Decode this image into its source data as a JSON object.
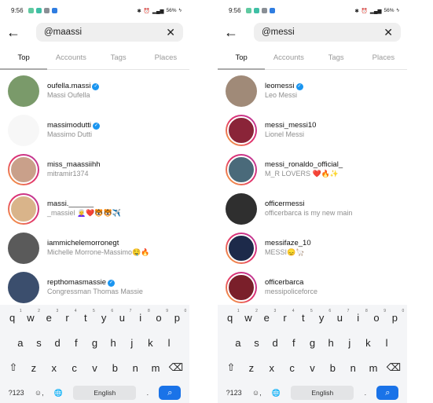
{
  "status_bar": {
    "time": "9:56",
    "battery": "56%",
    "app_colors": [
      "#5fc9a0",
      "#3fbfa5",
      "#8a8f95",
      "#2f7de1"
    ]
  },
  "tabs": [
    "Top",
    "Accounts",
    "Tags",
    "Places"
  ],
  "active_tab": "Top",
  "panels": [
    {
      "query": "@maassi",
      "results": [
        {
          "username": "oufella.massi",
          "subtitle": "Massi Oufella",
          "verified": true,
          "story_ring": false,
          "avatar_color": "#7a9a6a"
        },
        {
          "username": "massimodutti",
          "subtitle": "Massimo Dutti",
          "verified": true,
          "story_ring": false,
          "avatar_color": "#f7f7f7"
        },
        {
          "username": "miss_maassiihh",
          "subtitle": "mitramir1374",
          "verified": false,
          "story_ring": true,
          "avatar_color": "#c9a08a"
        },
        {
          "username": "massi.______",
          "subtitle": "_massiel 👩‍🦳❤️🐯🐯✈️",
          "verified": false,
          "story_ring": true,
          "avatar_color": "#d9b48a"
        },
        {
          "username": "iammichelemorronegt",
          "subtitle": "Michelle Morrone-Massimo🤤🔥",
          "verified": false,
          "story_ring": false,
          "avatar_color": "#5a5a5a"
        },
        {
          "username": "repthomasmassie",
          "subtitle": "Congressman Thomas Massie",
          "verified": true,
          "story_ring": false,
          "avatar_color": "#3b4e6d"
        }
      ]
    },
    {
      "query": "@messi",
      "results": [
        {
          "username": "leomessi",
          "subtitle": "Leo Messi",
          "verified": true,
          "story_ring": false,
          "avatar_color": "#a08a78"
        },
        {
          "username": "messi_messi10",
          "subtitle": "Lionel Messi",
          "verified": false,
          "story_ring": true,
          "avatar_color": "#8a2438"
        },
        {
          "username": "messi_ronaldo_official_",
          "subtitle": "M_R LOVERS ❤️🔥✨",
          "verified": false,
          "story_ring": true,
          "avatar_color": "#4a6a7a"
        },
        {
          "username": "officermessi",
          "subtitle": "officerbarca is my new main",
          "verified": false,
          "story_ring": false,
          "avatar_color": "#2f2f2f"
        },
        {
          "username": "messifaze_10",
          "subtitle": "MESSI😞🦙",
          "verified": false,
          "story_ring": true,
          "avatar_color": "#1d2a4a"
        },
        {
          "username": "officerbarca",
          "subtitle": "messipoliceforce",
          "verified": false,
          "story_ring": true,
          "avatar_color": "#7a1f2a"
        }
      ]
    }
  ],
  "keyboard": {
    "row1": [
      "q",
      "w",
      "e",
      "r",
      "t",
      "y",
      "u",
      "i",
      "o",
      "p"
    ],
    "row1_hints": [
      "1",
      "2",
      "3",
      "4",
      "5",
      "6",
      "7",
      "8",
      "9",
      "0"
    ],
    "row2": [
      "a",
      "s",
      "d",
      "f",
      "g",
      "h",
      "j",
      "k",
      "l"
    ],
    "row3": [
      "z",
      "x",
      "c",
      "v",
      "b",
      "n",
      "m"
    ],
    "symbols_label": "?123",
    "space_label": "English",
    "period": "."
  }
}
